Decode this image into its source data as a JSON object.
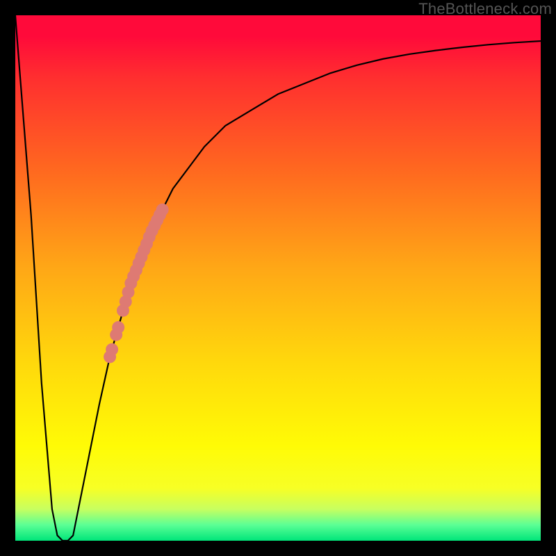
{
  "watermark": "TheBottleneck.com",
  "chart_data": {
    "type": "line",
    "title": "",
    "xlabel": "",
    "ylabel": "",
    "xlim": [
      0,
      100
    ],
    "ylim": [
      0,
      100
    ],
    "curve": {
      "x": [
        0,
        3,
        5,
        7,
        8,
        9,
        10,
        11,
        12,
        14,
        16,
        18,
        20,
        22,
        24,
        26,
        28,
        30,
        33,
        36,
        40,
        45,
        50,
        55,
        60,
        65,
        70,
        75,
        80,
        85,
        90,
        95,
        100
      ],
      "y": [
        100,
        62,
        30,
        6,
        1,
        0,
        0,
        1,
        6,
        16,
        26,
        35,
        42,
        49,
        54,
        59,
        63,
        67,
        71,
        75,
        79,
        82,
        85,
        87,
        89,
        90.5,
        91.7,
        92.6,
        93.3,
        93.9,
        94.4,
        94.8,
        95.1
      ]
    },
    "highlight_points": {
      "color": "#de7a73",
      "points": [
        {
          "x": 18.0,
          "y": 35.0
        },
        {
          "x": 18.4,
          "y": 36.4
        },
        {
          "x": 19.2,
          "y": 39.2
        },
        {
          "x": 19.6,
          "y": 40.6
        },
        {
          "x": 20.5,
          "y": 43.8
        },
        {
          "x": 21.0,
          "y": 45.5
        },
        {
          "x": 21.5,
          "y": 47.3
        },
        {
          "x": 22.0,
          "y": 49.0
        },
        {
          "x": 22.5,
          "y": 50.3
        },
        {
          "x": 23.0,
          "y": 51.5
        },
        {
          "x": 23.5,
          "y": 52.8
        },
        {
          "x": 24.0,
          "y": 54.0
        },
        {
          "x": 24.5,
          "y": 55.3
        },
        {
          "x": 25.0,
          "y": 56.5
        },
        {
          "x": 25.5,
          "y": 57.8
        },
        {
          "x": 26.0,
          "y": 59.0
        },
        {
          "x": 26.5,
          "y": 60.0
        },
        {
          "x": 27.0,
          "y": 61.0
        },
        {
          "x": 27.5,
          "y": 62.0
        },
        {
          "x": 28.0,
          "y": 63.0
        }
      ]
    }
  }
}
